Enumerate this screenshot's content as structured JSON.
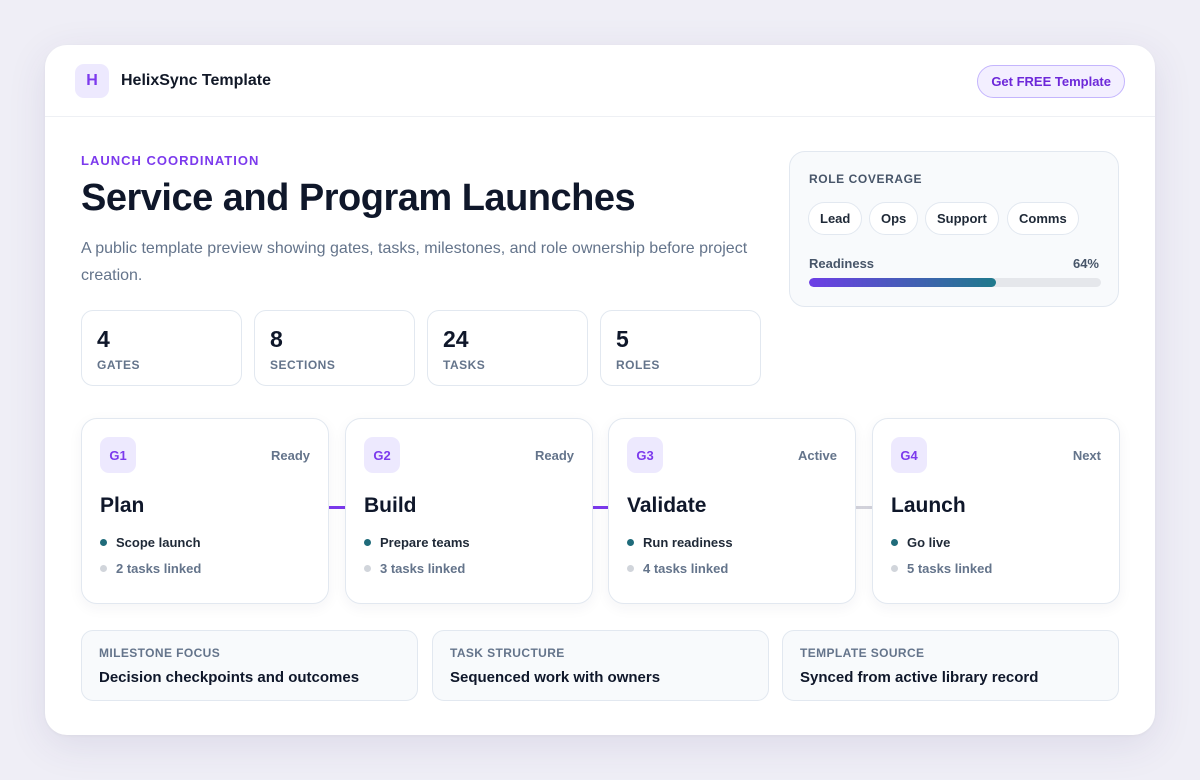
{
  "header": {
    "logo_letter": "H",
    "brand": "HelixSync Template",
    "cta": "Get FREE Template"
  },
  "hero": {
    "eyebrow": "LAUNCH COORDINATION",
    "title": "Service and Program Launches",
    "subtitle": "A public template preview showing gates, tasks, milestones, and role ownership before project creation."
  },
  "stats": [
    {
      "value": "4",
      "label": "GATES"
    },
    {
      "value": "8",
      "label": "SECTIONS"
    },
    {
      "value": "24",
      "label": "TASKS"
    },
    {
      "value": "5",
      "label": "ROLES"
    }
  ],
  "role_coverage": {
    "title": "ROLE COVERAGE",
    "roles": [
      "Lead",
      "Ops",
      "Support",
      "Comms"
    ],
    "readiness_label": "Readiness",
    "readiness_value": "64%",
    "readiness_fraction": 0.64
  },
  "gates": [
    {
      "code": "G1",
      "status": "Ready",
      "name": "Plan",
      "task": "Scope launch",
      "count": "2 tasks linked"
    },
    {
      "code": "G2",
      "status": "Ready",
      "name": "Build",
      "task": "Prepare teams",
      "count": "3 tasks linked"
    },
    {
      "code": "G3",
      "status": "Active",
      "name": "Validate",
      "task": "Run readiness",
      "count": "4 tasks linked"
    },
    {
      "code": "G4",
      "status": "Next",
      "name": "Launch",
      "task": "Go live",
      "count": "5 tasks linked"
    }
  ],
  "connector_colors": [
    "#7c3aed",
    "#7c3aed",
    "#d4d4dc"
  ],
  "footer_cards": [
    {
      "label": "MILESTONE FOCUS",
      "value": "Decision checkpoints and outcomes"
    },
    {
      "label": "TASK STRUCTURE",
      "value": "Sequenced work with owners"
    },
    {
      "label": "TEMPLATE SOURCE",
      "value": "Synced from active library record"
    }
  ]
}
